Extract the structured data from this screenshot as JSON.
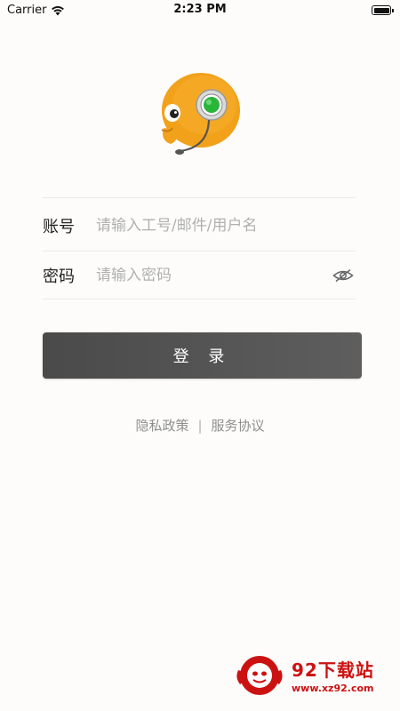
{
  "status_bar": {
    "carrier": "Carrier",
    "time": "2:23 PM",
    "wifi_icon": "wifi-icon",
    "battery_icon": "battery-icon"
  },
  "logo": {
    "icon": "customer-service-mascot-logo",
    "colors": {
      "face": "#f2a11b",
      "headset_ring": "#d8d8d8",
      "headset_light": "#29b53a"
    }
  },
  "form": {
    "account": {
      "label": "账号",
      "value": "",
      "placeholder": "请输入工号/邮件/用户名"
    },
    "password": {
      "label": "密码",
      "value": "",
      "placeholder": "请输入密码",
      "toggle_icon": "eye-slash-icon"
    }
  },
  "login_button": {
    "label": "登 录",
    "color": "#555555"
  },
  "policy": {
    "privacy_label": "隐私政策",
    "separator": "|",
    "service_label": "服务协议"
  },
  "watermark": {
    "title": "92下载站",
    "url": "www.xz92.com",
    "color": "#cc1111"
  }
}
